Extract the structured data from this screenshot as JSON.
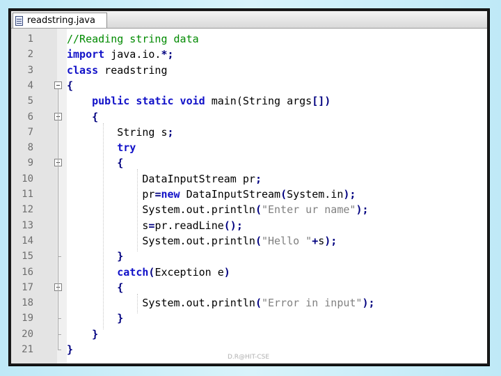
{
  "tab": {
    "filename": "readstring.java"
  },
  "lines": [
    {
      "n": "1",
      "segs": [
        {
          "t": "//Reading string data",
          "c": "cm"
        }
      ]
    },
    {
      "n": "2",
      "segs": [
        {
          "t": "import",
          "c": "kw"
        },
        {
          "t": " java.io.",
          "c": ""
        },
        {
          "t": "*;",
          "c": "op"
        }
      ]
    },
    {
      "n": "3",
      "segs": [
        {
          "t": "class",
          "c": "kw"
        },
        {
          "t": " readstring",
          "c": ""
        }
      ]
    },
    {
      "n": "4",
      "segs": [
        {
          "t": "{",
          "c": "op"
        }
      ]
    },
    {
      "n": "5",
      "segs": [
        {
          "t": "    ",
          "c": ""
        },
        {
          "t": "public static void",
          "c": "kw"
        },
        {
          "t": " main(String args",
          "c": ""
        },
        {
          "t": "[])",
          "c": "op"
        }
      ]
    },
    {
      "n": "6",
      "segs": [
        {
          "t": "    ",
          "c": ""
        },
        {
          "t": "{",
          "c": "op"
        }
      ]
    },
    {
      "n": "7",
      "segs": [
        {
          "t": "        String s",
          "c": ""
        },
        {
          "t": ";",
          "c": "op"
        }
      ]
    },
    {
      "n": "8",
      "segs": [
        {
          "t": "        ",
          "c": ""
        },
        {
          "t": "try",
          "c": "kw"
        }
      ]
    },
    {
      "n": "9",
      "segs": [
        {
          "t": "        ",
          "c": ""
        },
        {
          "t": "{",
          "c": "op"
        }
      ]
    },
    {
      "n": "10",
      "segs": [
        {
          "t": "            DataInputStream pr",
          "c": ""
        },
        {
          "t": ";",
          "c": "op"
        }
      ]
    },
    {
      "n": "11",
      "segs": [
        {
          "t": "            pr",
          "c": ""
        },
        {
          "t": "=",
          "c": "op"
        },
        {
          "t": "new",
          "c": "kw"
        },
        {
          "t": " DataInputStream",
          "c": ""
        },
        {
          "t": "(",
          "c": "op"
        },
        {
          "t": "System.in",
          "c": ""
        },
        {
          "t": ");",
          "c": "op"
        }
      ]
    },
    {
      "n": "12",
      "segs": [
        {
          "t": "            System.out.println",
          "c": ""
        },
        {
          "t": "(",
          "c": "op"
        },
        {
          "t": "\"Enter ur name\"",
          "c": "st"
        },
        {
          "t": ");",
          "c": "op"
        }
      ]
    },
    {
      "n": "13",
      "segs": [
        {
          "t": "            s",
          "c": ""
        },
        {
          "t": "=",
          "c": "op"
        },
        {
          "t": "pr.readLine",
          "c": ""
        },
        {
          "t": "();",
          "c": "op"
        }
      ]
    },
    {
      "n": "14",
      "segs": [
        {
          "t": "            System.out.println",
          "c": ""
        },
        {
          "t": "(",
          "c": "op"
        },
        {
          "t": "\"Hello \"",
          "c": "st"
        },
        {
          "t": "+",
          "c": "op"
        },
        {
          "t": "s",
          "c": ""
        },
        {
          "t": ");",
          "c": "op"
        }
      ]
    },
    {
      "n": "15",
      "segs": [
        {
          "t": "        ",
          "c": ""
        },
        {
          "t": "}",
          "c": "op"
        }
      ]
    },
    {
      "n": "16",
      "segs": [
        {
          "t": "        ",
          "c": ""
        },
        {
          "t": "catch",
          "c": "kw"
        },
        {
          "t": "(",
          "c": "op"
        },
        {
          "t": "Exception e",
          "c": ""
        },
        {
          "t": ")",
          "c": "op"
        }
      ]
    },
    {
      "n": "17",
      "segs": [
        {
          "t": "        ",
          "c": ""
        },
        {
          "t": "{",
          "c": "op"
        }
      ]
    },
    {
      "n": "18",
      "segs": [
        {
          "t": "            System.out.println",
          "c": ""
        },
        {
          "t": "(",
          "c": "op"
        },
        {
          "t": "\"Error in input\"",
          "c": "st"
        },
        {
          "t": ");",
          "c": "op"
        }
      ]
    },
    {
      "n": "19",
      "segs": [
        {
          "t": "        ",
          "c": ""
        },
        {
          "t": "}",
          "c": "op"
        }
      ]
    },
    {
      "n": "20",
      "segs": [
        {
          "t": "    ",
          "c": ""
        },
        {
          "t": "}",
          "c": "op"
        }
      ]
    },
    {
      "n": "21",
      "segs": [
        {
          "t": "}",
          "c": "op"
        }
      ]
    }
  ],
  "fold_open_lines": [
    "4",
    "6",
    "9",
    "17"
  ],
  "fold_end_lines": [
    "15",
    "19",
    "20",
    "21"
  ],
  "footer": {
    "text": "D.R@HIT-CSE"
  },
  "colors": {
    "keyword": "#1010c8",
    "comment": "#008a00",
    "string": "#808080"
  }
}
